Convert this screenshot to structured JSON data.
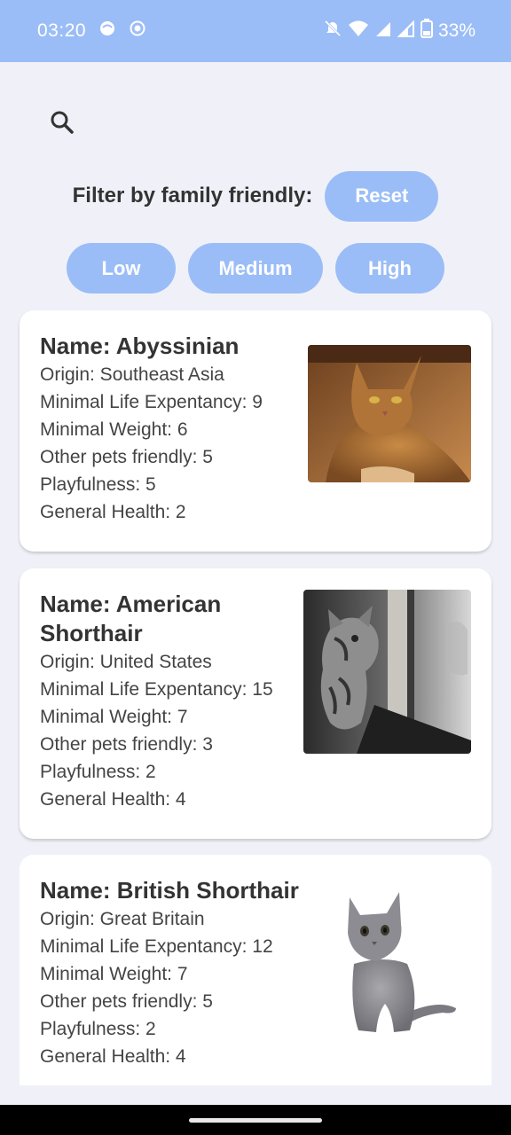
{
  "status_bar": {
    "time": "03:20",
    "battery": "33%",
    "icons": [
      "face-icon",
      "record-icon",
      "mute-icon",
      "wifi-icon",
      "signal-icon",
      "signal-icon",
      "battery-icon"
    ]
  },
  "toolbar": {
    "search_icon": "search-icon"
  },
  "filter": {
    "label": "Filter by family friendly:",
    "reset_label": "Reset",
    "levels": [
      "Low",
      "Medium",
      "High"
    ]
  },
  "colors": {
    "accent": "#9bbdf7",
    "background": "#f0f1f8",
    "card": "#ffffff",
    "text": "#333333"
  },
  "breeds": [
    {
      "name": "Name: Abyssinian",
      "origin": "Origin: Southeast Asia",
      "life": "Minimal Life Expentancy: 9",
      "weight": "Minimal Weight: 6",
      "pets": "Other pets friendly: 5",
      "play": "Playfulness: 5",
      "health": "General Health: 2",
      "image": "abyssinian-cat-photo"
    },
    {
      "name": "Name: American Shorthair",
      "origin": "Origin: United States",
      "life": "Minimal Life Expentancy: 15",
      "weight": "Minimal Weight: 7",
      "pets": "Other pets friendly: 3",
      "play": "Playfulness: 2",
      "health": "General Health: 4",
      "image": "american-shorthair-cat-photo"
    },
    {
      "name": "Name: British Shorthair",
      "origin": "Origin: Great Britain",
      "life": "Minimal Life Expentancy: 12",
      "weight": "Minimal Weight: 7",
      "pets": "Other pets friendly: 5",
      "play": "Playfulness: 2",
      "health": "General Health: 4",
      "image": "british-shorthair-cat-photo"
    }
  ]
}
